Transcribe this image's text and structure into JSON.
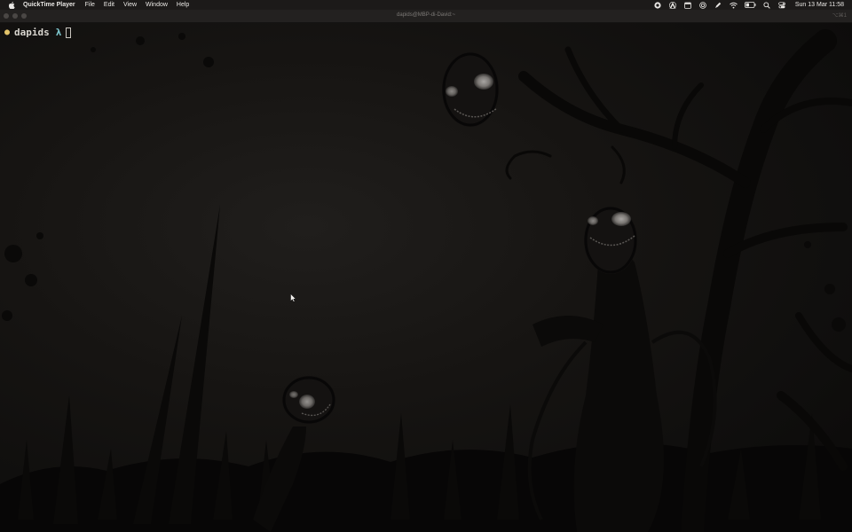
{
  "menubar": {
    "apple_icon": "apple-logo-icon",
    "items": [
      {
        "label": "QuickTime Player",
        "bold": true
      },
      {
        "label": "File"
      },
      {
        "label": "Edit"
      },
      {
        "label": "View"
      },
      {
        "label": "Window"
      },
      {
        "label": "Help"
      }
    ],
    "status_icons": [
      "record-icon",
      "adobe-icon",
      "calendar-icon",
      "target-icon",
      "pen-icon",
      "wifi-icon",
      "battery-icon",
      "search-icon",
      "control-center-icon"
    ],
    "clock": "Sun 13 Mar  11:58"
  },
  "window": {
    "title": "dapids@MBP-di-David:~",
    "shortcut": "⌥⌘1"
  },
  "terminal": {
    "prompt_dot": "●",
    "user": "dapids",
    "lambda": "λ"
  },
  "colors": {
    "prompt_dot": "#e3c46a",
    "prompt_user": "#d8d5cf",
    "prompt_lambda": "#7ec8cf",
    "background": "#161412"
  }
}
